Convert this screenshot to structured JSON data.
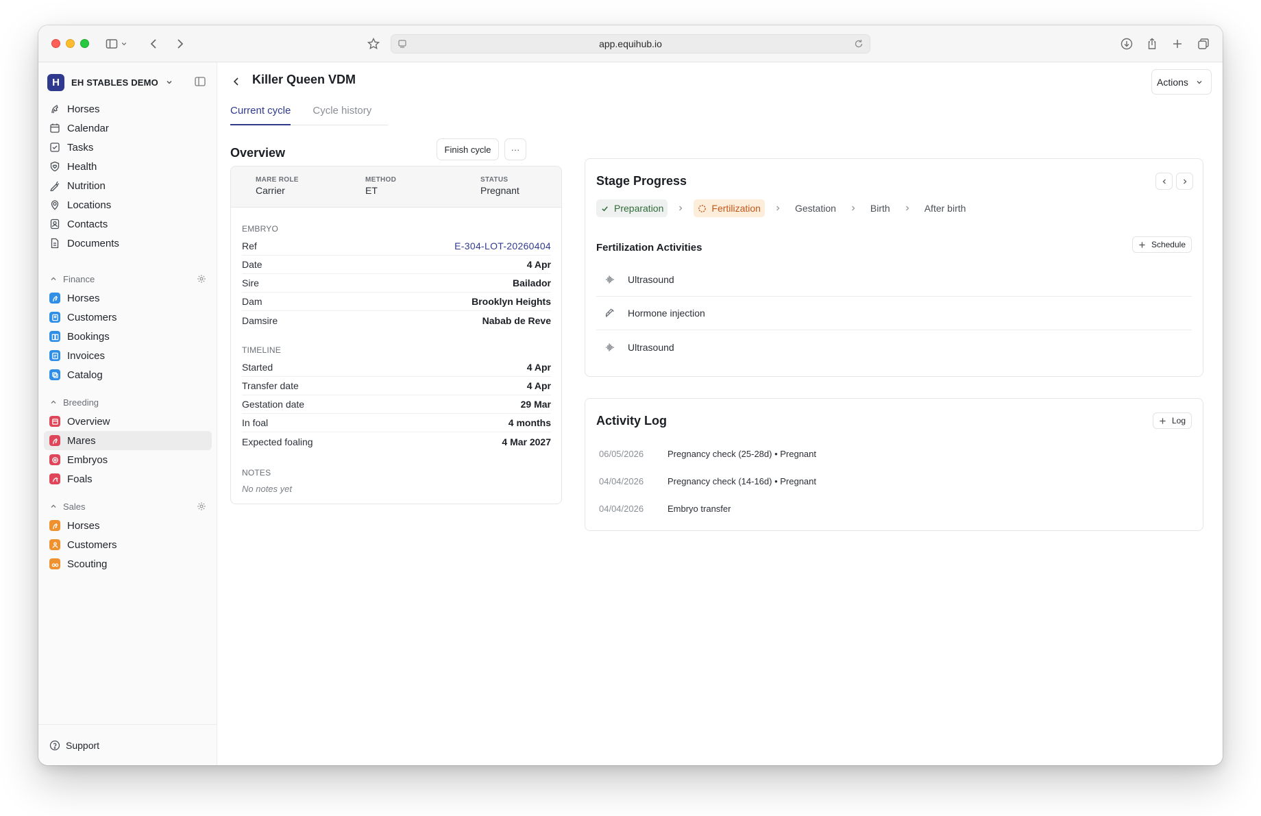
{
  "browser": {
    "url": "app.equihub.io"
  },
  "sidebar": {
    "org_initial": "H",
    "org_name": "EH STABLES DEMO",
    "main_items": [
      {
        "label": "Horses",
        "icon": "horse-icon"
      },
      {
        "label": "Calendar",
        "icon": "calendar-icon"
      },
      {
        "label": "Tasks",
        "icon": "checkbox-icon"
      },
      {
        "label": "Health",
        "icon": "heart-shield-icon"
      },
      {
        "label": "Nutrition",
        "icon": "carrot-icon"
      },
      {
        "label": "Locations",
        "icon": "map-pin-icon"
      },
      {
        "label": "Contacts",
        "icon": "contact-icon"
      },
      {
        "label": "Documents",
        "icon": "document-icon"
      }
    ],
    "finance": {
      "label": "Finance",
      "color": "#2f8fe6",
      "items": [
        {
          "label": "Horses"
        },
        {
          "label": "Customers"
        },
        {
          "label": "Bookings"
        },
        {
          "label": "Invoices"
        },
        {
          "label": "Catalog"
        }
      ]
    },
    "breeding": {
      "label": "Breeding",
      "color": "#e0465a",
      "items": [
        {
          "label": "Overview"
        },
        {
          "label": "Mares",
          "active": true
        },
        {
          "label": "Embryos"
        },
        {
          "label": "Foals"
        }
      ]
    },
    "sales": {
      "label": "Sales",
      "color": "#f0912f",
      "items": [
        {
          "label": "Horses"
        },
        {
          "label": "Customers"
        },
        {
          "label": "Scouting"
        }
      ]
    },
    "support_label": "Support"
  },
  "header": {
    "title": "Killer Queen VDM",
    "actions_label": "Actions",
    "tabs": [
      {
        "label": "Current cycle",
        "active": true
      },
      {
        "label": "Cycle history",
        "active": false
      }
    ]
  },
  "overview": {
    "title": "Overview",
    "finish_label": "Finish cycle",
    "more_label": "···",
    "summary": [
      {
        "label": "MARE ROLE",
        "value": "Carrier"
      },
      {
        "label": "METHOD",
        "value": "ET"
      },
      {
        "label": "STATUS",
        "value": "Pregnant"
      }
    ],
    "embryo_label": "EMBRYO",
    "embryo": [
      {
        "k": "Ref",
        "v": "E-304-LOT-20260404"
      },
      {
        "k": "Date",
        "v": "4 Apr"
      },
      {
        "k": "Sire",
        "v": "Bailador"
      },
      {
        "k": "Dam",
        "v": "Brooklyn Heights"
      },
      {
        "k": "Damsire",
        "v": "Nabab de Reve"
      }
    ],
    "timeline_label": "TIMELINE",
    "timeline": [
      {
        "k": "Started",
        "v": "4 Apr"
      },
      {
        "k": "Transfer date",
        "v": "4 Apr"
      },
      {
        "k": "Gestation date",
        "v": "29 Mar"
      },
      {
        "k": "In foal",
        "v": "4 months"
      },
      {
        "k": "Expected foaling",
        "v": "4 Mar 2027"
      }
    ],
    "notes_label": "NOTES",
    "notes_empty": "No notes yet"
  },
  "stage_progress": {
    "title": "Stage Progress",
    "stages": [
      {
        "label": "Preparation",
        "state": "done"
      },
      {
        "label": "Fertilization",
        "state": "current"
      },
      {
        "label": "Gestation",
        "state": "pending"
      },
      {
        "label": "Birth",
        "state": "pending"
      },
      {
        "label": "After birth",
        "state": "pending"
      }
    ],
    "activities_title": "Fertilization Activities",
    "schedule_label": "Schedule",
    "activities": [
      {
        "label": "Ultrasound",
        "icon": "ultrasound-icon"
      },
      {
        "label": "Hormone injection",
        "icon": "syringe-icon"
      },
      {
        "label": "Ultrasound",
        "icon": "ultrasound-icon"
      }
    ]
  },
  "activity_log": {
    "title": "Activity Log",
    "log_label": "Log",
    "entries": [
      {
        "date": "06/05/2026",
        "text": "Pregnancy check (25-28d) • Pregnant"
      },
      {
        "date": "04/04/2026",
        "text": "Pregnancy check (14-16d) • Pregnant"
      },
      {
        "date": "04/04/2026",
        "text": "Embryo transfer"
      }
    ]
  },
  "colors": {
    "brand": "#2f3a8f",
    "stage_done_bg": "#eef1ef",
    "stage_current_bg": "#fdeedc"
  }
}
